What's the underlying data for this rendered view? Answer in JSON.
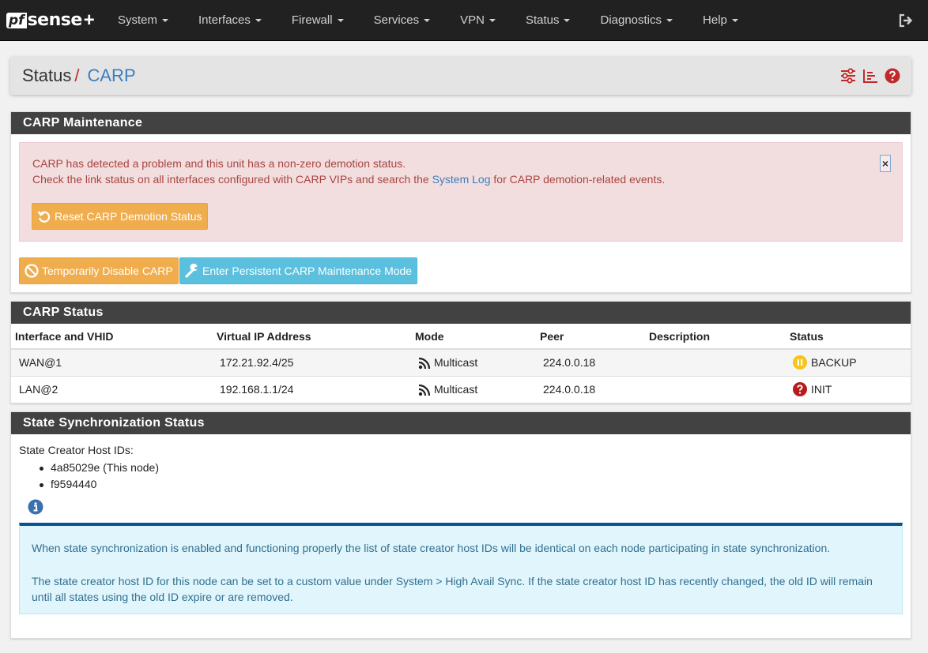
{
  "brand": {
    "pf": "pf",
    "sense": "sense",
    "plus": "+"
  },
  "nav": {
    "items": [
      {
        "label": "System"
      },
      {
        "label": "Interfaces"
      },
      {
        "label": "Firewall"
      },
      {
        "label": "Services"
      },
      {
        "label": "VPN"
      },
      {
        "label": "Status"
      },
      {
        "label": "Diagnostics"
      },
      {
        "label": "Help"
      }
    ],
    "logout_icon": "logout-icon"
  },
  "breadcrumb": {
    "parent": "Status",
    "separator": "/",
    "current": "CARP"
  },
  "header_icons": [
    "sliders-icon",
    "log-chart-icon",
    "help-icon"
  ],
  "maintenance": {
    "title": "CARP Maintenance",
    "alert_line1": "CARP has detected a problem and this unit has a non-zero demotion status.",
    "alert_line2_pre": "Check the link status on all interfaces configured with CARP VIPs and search the ",
    "alert_line2_link": "System Log",
    "alert_line2_post": " for CARP demotion-related events.",
    "close_label": "×",
    "reset_button": "Reset CARP Demotion Status",
    "disable_button": "Temporarily Disable CARP",
    "maintenance_button": "Enter Persistent CARP Maintenance Mode"
  },
  "carp_status": {
    "title": "CARP Status",
    "columns": [
      "Interface and VHID",
      "Virtual IP Address",
      "Mode",
      "Peer",
      "Description",
      "Status"
    ],
    "rows": [
      {
        "iface": "WAN@1",
        "vip": "172.21.92.4/25",
        "mode": "Multicast",
        "peer": "224.0.0.18",
        "description": "",
        "status": "BACKUP",
        "status_icon": "pause-circle-icon",
        "status_color": "#f5c518"
      },
      {
        "iface": "LAN@2",
        "vip": "192.168.1.1/24",
        "mode": "Multicast",
        "peer": "224.0.0.18",
        "description": "",
        "status": "INIT",
        "status_icon": "question-circle-icon",
        "status_color": "#b71c1c"
      }
    ]
  },
  "state_sync": {
    "title": "State Synchronization Status",
    "label": "State Creator Host IDs:",
    "host_ids": [
      "4a85029e (This node)",
      "f9594440"
    ],
    "info_p1": "When state synchronization is enabled and functioning properly the list of state creator host IDs will be identical on each node participating in state synchronization.",
    "info_p2": "The state creator host ID for this node can be set to a custom value under System > High Avail Sync. If the state creator host ID has recently changed, the old ID will remain until all states using the old ID expire or are removed."
  },
  "colors": {
    "navbar": "#212121",
    "panel_heading": "#424242",
    "link": "#3a7fbf",
    "danger_bg": "#f2dede",
    "danger_text": "#a94442",
    "warning_btn": "#f0ad4e",
    "info_btn": "#5bc0de",
    "info_bg": "#e1f5fc",
    "info_border": "#0a5390",
    "icon_red": "#c12a2a"
  }
}
